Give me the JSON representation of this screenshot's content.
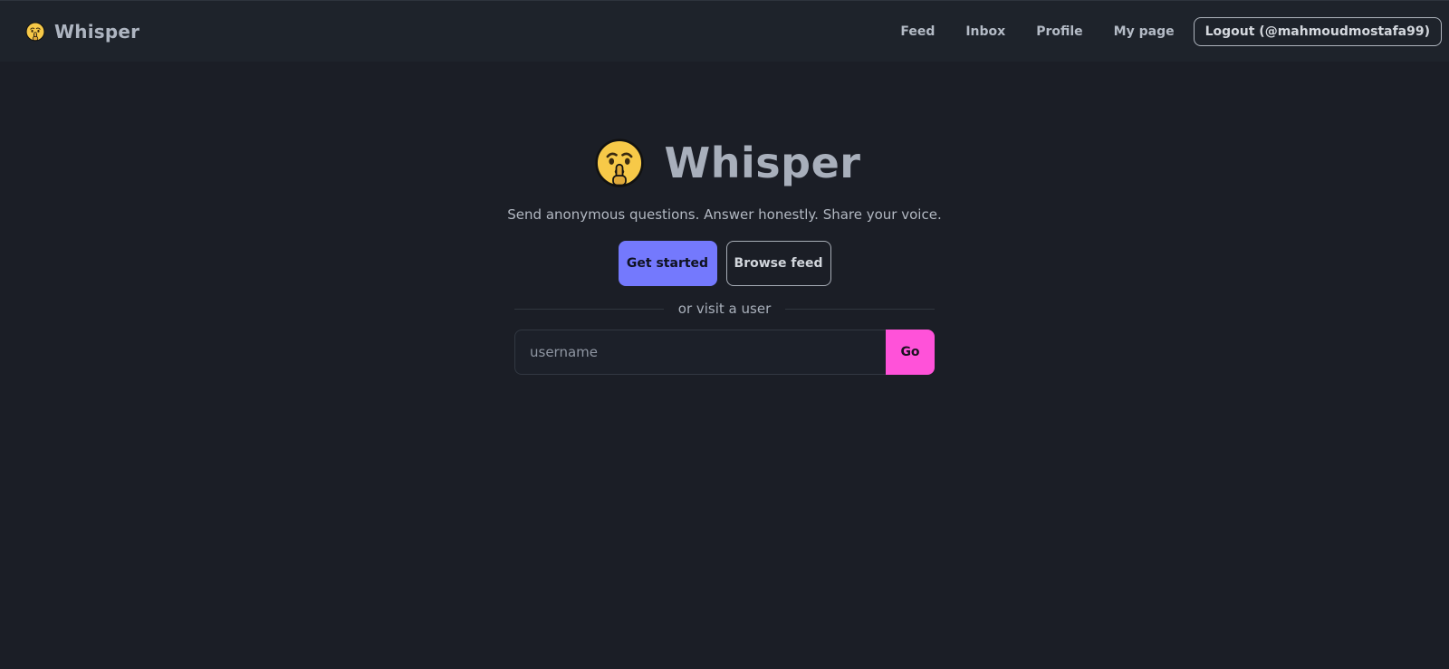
{
  "navbar": {
    "brand": {
      "icon": "shushing-face-icon",
      "label": "Whisper"
    },
    "links": [
      {
        "label": "Feed"
      },
      {
        "label": "Inbox"
      },
      {
        "label": "Profile"
      },
      {
        "label": "My page"
      }
    ],
    "logout_label": "Logout (@mahmoudmostafa99)"
  },
  "hero": {
    "icon": "shushing-face-icon",
    "title": "Whisper",
    "tagline": "Send anonymous questions. Answer honestly. Share your voice.",
    "primary_button": "Get started",
    "secondary_button": "Browse feed",
    "divider_text": "or visit a user",
    "username_placeholder": "username",
    "username_value": "",
    "go_button": "Go"
  },
  "colors": {
    "background": "#1b1e26",
    "navbar": "#1e232b",
    "primary_accent": "#7479fd",
    "go_accent": "#ff52d9",
    "emoji_yellow": "#f7c948"
  }
}
